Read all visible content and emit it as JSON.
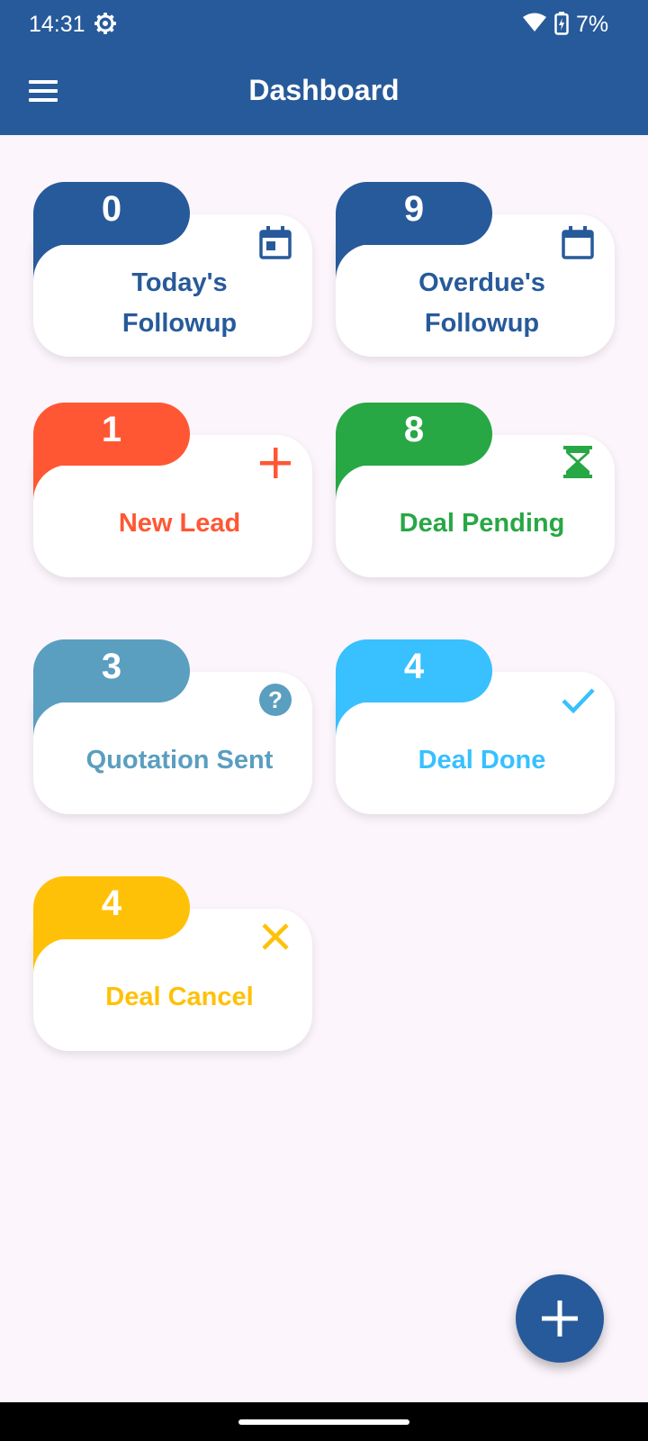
{
  "status": {
    "time": "14:31",
    "battery": "7%"
  },
  "app_bar": {
    "title": "Dashboard"
  },
  "cards": [
    {
      "count": "0",
      "line1": "Today's",
      "line2": "Followup",
      "color": "#275A9A",
      "icon": "calendar-today-icon"
    },
    {
      "count": "9",
      "line1": "Overdue's",
      "line2": "Followup",
      "color": "#275A9A",
      "icon": "calendar-icon"
    },
    {
      "count": "1",
      "label": "New Lead",
      "color": "#FF5733",
      "icon": "plus-icon"
    },
    {
      "count": "8",
      "label": "Deal Pending",
      "color": "#28A745",
      "icon": "hourglass-icon"
    },
    {
      "count": "3",
      "label": "Quotation Sent",
      "color": "#5A9EC0",
      "icon": "help-circle-icon"
    },
    {
      "count": "4",
      "label": "Deal Done",
      "color": "#38C0FF",
      "icon": "check-icon"
    },
    {
      "count": "4",
      "label": "Deal Cancel",
      "color": "#FFC107",
      "icon": "close-icon"
    }
  ],
  "fab": {
    "icon": "plus-icon",
    "color": "#275A9A"
  }
}
